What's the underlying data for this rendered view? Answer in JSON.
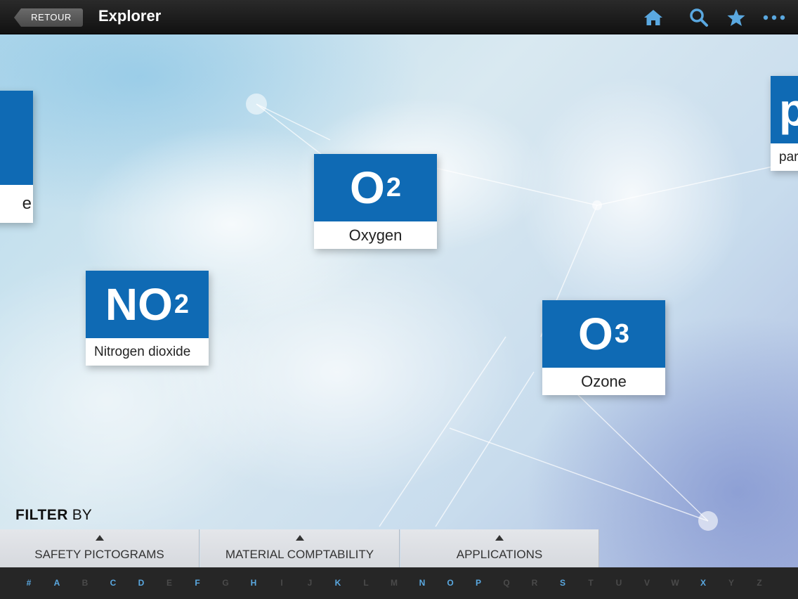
{
  "header": {
    "back_label": "RETOUR",
    "title": "Explorer",
    "icons": [
      "home-icon",
      "search-icon",
      "star-icon",
      "more-icon"
    ],
    "icon_color": "#5aa8e0"
  },
  "cards": {
    "left_partial": {
      "label": "e"
    },
    "oxygen": {
      "formula": "O",
      "sub": "2",
      "label": "Oxygen"
    },
    "no2": {
      "formula": "NO",
      "sub": "2",
      "label": "Nitrogen dioxide"
    },
    "ozone": {
      "formula": "O",
      "sub": "3",
      "label": "Ozone"
    },
    "right_partial": {
      "formula": "p",
      "label": "par"
    }
  },
  "filter": {
    "title_bold": "FILTER",
    "title_rest": "BY",
    "tabs": [
      "SAFETY PICTOGRAMS",
      "MATERIAL COMPTABILITY",
      "APPLICATIONS"
    ]
  },
  "alphabet": [
    {
      "l": "#",
      "on": true
    },
    {
      "l": "A",
      "on": true
    },
    {
      "l": "B",
      "on": false
    },
    {
      "l": "C",
      "on": true
    },
    {
      "l": "D",
      "on": true
    },
    {
      "l": "E",
      "on": false
    },
    {
      "l": "F",
      "on": true
    },
    {
      "l": "G",
      "on": false
    },
    {
      "l": "H",
      "on": true
    },
    {
      "l": "I",
      "on": false
    },
    {
      "l": "J",
      "on": false
    },
    {
      "l": "K",
      "on": true
    },
    {
      "l": "L",
      "on": false
    },
    {
      "l": "M",
      "on": false
    },
    {
      "l": "N",
      "on": true
    },
    {
      "l": "O",
      "on": true
    },
    {
      "l": "P",
      "on": true
    },
    {
      "l": "Q",
      "on": false
    },
    {
      "l": "R",
      "on": false
    },
    {
      "l": "S",
      "on": true
    },
    {
      "l": "T",
      "on": false
    },
    {
      "l": "U",
      "on": false
    },
    {
      "l": "V",
      "on": false
    },
    {
      "l": "W",
      "on": false
    },
    {
      "l": "X",
      "on": true
    },
    {
      "l": "Y",
      "on": false
    },
    {
      "l": "Z",
      "on": false
    }
  ],
  "colors": {
    "card_blue": "#0f6ab4",
    "active_letter": "#5aa8e0",
    "inactive_letter": "#4a4a4a"
  }
}
